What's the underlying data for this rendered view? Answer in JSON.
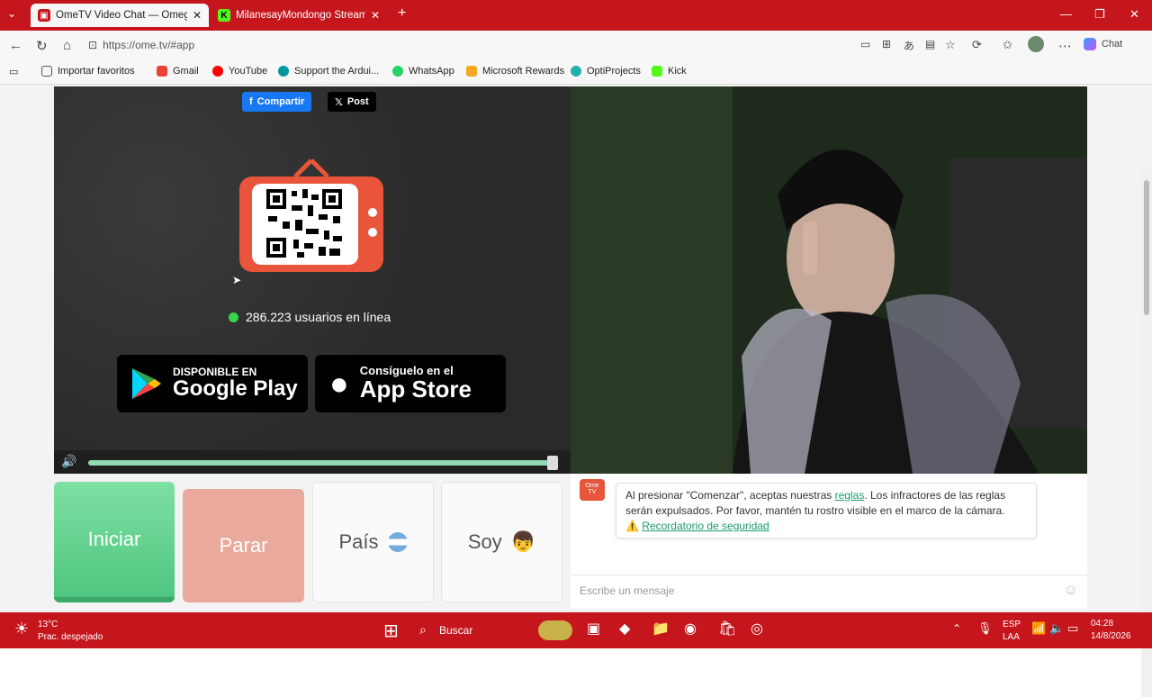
{
  "browser": {
    "tabs": [
      {
        "title": "OmeTV Video Chat — Omegl",
        "active": true
      },
      {
        "title": "MilanesayMondongo Stream - Wa",
        "active": false
      }
    ],
    "url": "https://ome.tv/#app"
  },
  "bookmarks": [
    "Importar favoritos",
    "Gmail",
    "YouTube",
    "Support the Ardui...",
    "WhatsApp",
    "Microsoft Rewards",
    "OptiProjects",
    "Kick"
  ],
  "toolbar_right": {
    "chat_label": "Chat"
  },
  "share": {
    "facebook": "Compartir",
    "x": "Post"
  },
  "online": {
    "text": "286.223 usuarios en línea"
  },
  "stores": {
    "google_small": "DISPONIBLE EN",
    "google_large": "Google Play",
    "apple_small": "Consíguelo en el",
    "apple_large": "App Store"
  },
  "controls": {
    "start": "Iniciar",
    "stop": "Parar",
    "country": "País",
    "me": "Soy"
  },
  "chat": {
    "notice_pre": "Al presionar \"Comenzar\", aceptas nuestras ",
    "notice_link": "reglas",
    "notice_post": ". Los infractores de las reglas serán expulsados. Por favor, mantén tu rostro visible en el marco de la cámara.",
    "safety_link": "Recordatorio de seguridad",
    "input_placeholder": "Escribe un mensaje"
  },
  "taskbar": {
    "temp": "13°C",
    "weather": "Prac. despejado",
    "search": "Buscar",
    "lang1": "ESP",
    "lang2": "LAA",
    "time": "04:28",
    "date": "14/8/2026"
  },
  "colors": {
    "accent": "#c5161d",
    "start": "#5fcf8a",
    "stop": "#e9a99d"
  }
}
